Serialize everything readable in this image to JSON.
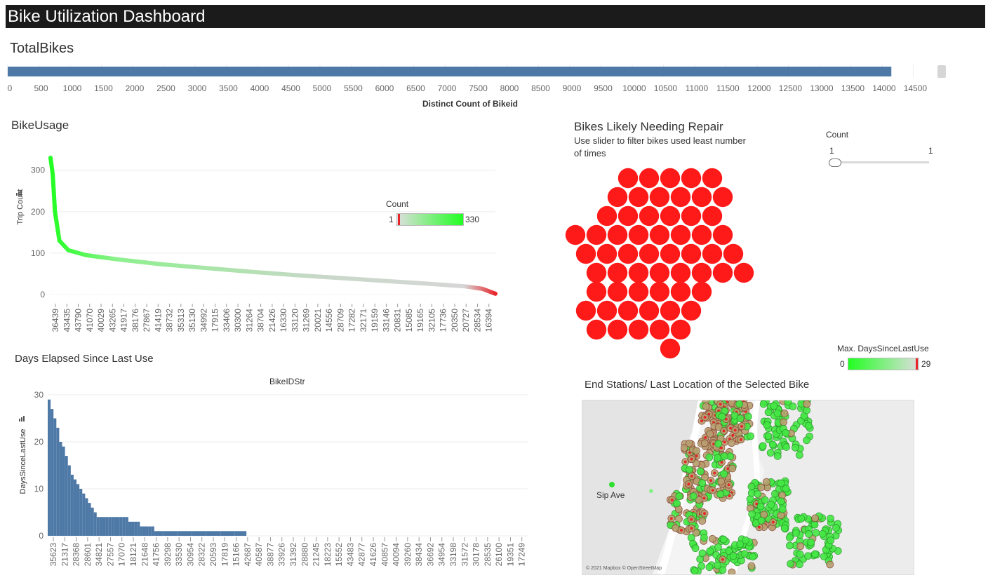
{
  "header": {
    "title": "Bike Utilization Dashboard"
  },
  "total_bikes": {
    "title": "TotalBikes",
    "axis_label": "Distinct Count of Bikeid",
    "chart_data": {
      "type": "bar",
      "orientation": "horizontal",
      "values": [
        14150
      ],
      "xlim": [
        0,
        14900
      ],
      "ticks": [
        "0",
        "500",
        "1000",
        "1500",
        "2000",
        "2500",
        "3000",
        "3500",
        "4000",
        "4500",
        "5000",
        "5500",
        "6000",
        "6500",
        "7000",
        "7500",
        "8000",
        "8500",
        "9000",
        "9500",
        "10000",
        "10500",
        "11000",
        "11500",
        "12000",
        "12500",
        "13000",
        "13500",
        "14000",
        "14500"
      ],
      "color": "#4e79a7"
    }
  },
  "bike_usage": {
    "title": "BikeUsage",
    "ylabel": "Trip Count",
    "legend": {
      "title": "Count",
      "min": "1",
      "max": "330"
    },
    "chart_data": {
      "type": "area",
      "ylim": [
        0,
        330
      ],
      "yticks": [
        "0",
        "100",
        "200",
        "300"
      ],
      "curve": [
        [
          0,
          330
        ],
        [
          0.005,
          290
        ],
        [
          0.01,
          200
        ],
        [
          0.02,
          130
        ],
        [
          0.04,
          107
        ],
        [
          0.08,
          95
        ],
        [
          0.15,
          85
        ],
        [
          0.25,
          73
        ],
        [
          0.35,
          64
        ],
        [
          0.45,
          55
        ],
        [
          0.55,
          47
        ],
        [
          0.65,
          40
        ],
        [
          0.75,
          33
        ],
        [
          0.85,
          26
        ],
        [
          0.93,
          20
        ],
        [
          0.97,
          14
        ],
        [
          1,
          2
        ]
      ],
      "xticks": [
        "36439",
        "43435",
        "43790",
        "41070",
        "40029",
        "43265",
        "41917",
        "38176",
        "27867",
        "41419",
        "38732",
        "35313",
        "35130",
        "34992",
        "17915",
        "33406",
        "30300",
        "31264",
        "38704",
        "21426",
        "16330",
        "33120",
        "31269",
        "20021",
        "14556",
        "28709",
        "17282",
        "32171",
        "19159",
        "33146",
        "20831",
        "15085",
        "19165",
        "32105",
        "17736",
        "20350",
        "20727",
        "28534",
        "16394"
      ],
      "color_low": "#e8252b",
      "color_mid": "#c8d8c8",
      "color_high": "#22ff22"
    }
  },
  "repair": {
    "title": "Bikes Likely Needing Repair",
    "subtitle_line1": "Use slider to filter bikes used least number",
    "subtitle_line2": "of times",
    "slider": {
      "label": "Count",
      "min": "1",
      "max": "1",
      "value": 1
    },
    "bubble_color": "#ff1a1a",
    "legend": {
      "title": "Max. DaysSinceLastUse",
      "min": "0",
      "max": "29"
    }
  },
  "days_elapsed": {
    "title": "Days Elapsed Since Last Use",
    "top_label": "BikeIDStr",
    "ylabel": "DaysSinceLastUse",
    "chart_data": {
      "type": "bar",
      "ylim": [
        0,
        30
      ],
      "yticks": [
        "0",
        "10",
        "20",
        "30"
      ],
      "steps": [
        [
          0.0,
          29
        ],
        [
          0.01,
          27
        ],
        [
          0.02,
          25
        ],
        [
          0.03,
          23
        ],
        [
          0.04,
          20
        ],
        [
          0.05,
          19
        ],
        [
          0.06,
          17
        ],
        [
          0.07,
          15
        ],
        [
          0.08,
          13
        ],
        [
          0.09,
          12
        ],
        [
          0.1,
          11
        ],
        [
          0.11,
          10
        ],
        [
          0.12,
          9
        ],
        [
          0.13,
          8
        ],
        [
          0.14,
          7
        ],
        [
          0.15,
          6
        ],
        [
          0.16,
          5
        ],
        [
          0.17,
          4
        ],
        [
          0.18,
          4
        ],
        [
          0.19,
          4
        ],
        [
          0.2,
          4
        ],
        [
          0.21,
          4
        ],
        [
          0.22,
          4
        ],
        [
          0.23,
          4
        ],
        [
          0.24,
          4
        ],
        [
          0.25,
          4
        ],
        [
          0.26,
          4
        ],
        [
          0.27,
          4
        ],
        [
          0.28,
          3
        ],
        [
          0.29,
          3
        ],
        [
          0.3,
          3
        ],
        [
          0.31,
          3
        ],
        [
          0.32,
          2
        ],
        [
          0.33,
          2
        ],
        [
          0.34,
          2
        ],
        [
          0.35,
          2
        ],
        [
          0.36,
          2
        ],
        [
          0.37,
          1
        ],
        [
          0.4,
          1
        ],
        [
          0.45,
          1
        ],
        [
          0.5,
          1
        ],
        [
          0.55,
          1
        ],
        [
          0.6,
          1
        ],
        [
          0.65,
          1
        ],
        [
          0.7,
          1
        ],
        [
          0.73,
          1
        ],
        [
          0.76,
          1
        ],
        [
          0.8,
          1
        ],
        [
          0.85,
          1
        ],
        [
          0.9,
          1
        ],
        [
          0.95,
          1
        ],
        [
          0.99,
          1
        ]
      ],
      "xticks": [
        "35623",
        "21317",
        "28368",
        "28601",
        "34821",
        "27557",
        "17070",
        "18121",
        "21648",
        "41756",
        "39298",
        "33530",
        "30954",
        "28322",
        "20593",
        "17819",
        "15166",
        "42687",
        "40587",
        "38877",
        "33926",
        "31392",
        "28880",
        "21245",
        "18223",
        "15552",
        "43483",
        "42877",
        "41626",
        "40857",
        "40094",
        "39260",
        "38434",
        "36692",
        "34954",
        "33198",
        "31572",
        "30178",
        "28535",
        "26100",
        "19351",
        "17249"
      ],
      "color": "#4e79a7"
    }
  },
  "map": {
    "title": "End Stations/ Last Location of the Selected Bike",
    "place_label": "Sip Ave",
    "attribution": "© 2021 Mapbox © OpenStreetMap"
  }
}
